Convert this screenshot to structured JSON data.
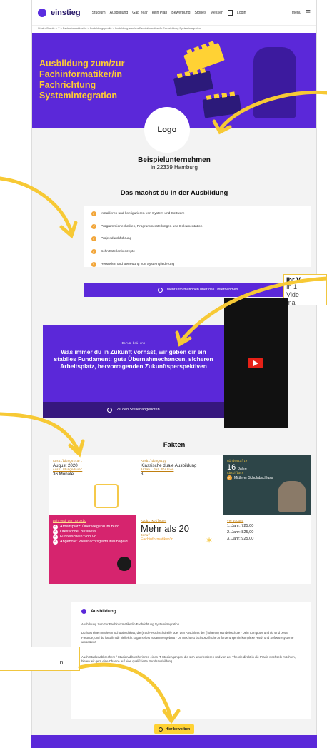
{
  "nav": {
    "brand": "einstieg",
    "links": [
      "Studium",
      "Ausbildung",
      "Gap Year",
      "kein Plan",
      "Bewerbung",
      "Stories",
      "Messen"
    ],
    "login": "Login",
    "menu": "menü"
  },
  "breadcrumb": "Start > Berufe A-Z > Fachinformatiker/-in > Ausbildungsprofile > Ausbildung zum/zur Fachinformatiker/in Fachrichtung Systemintegration",
  "hero": {
    "title": "Ausbildung zum/zur Fachinformatiker/in Fachrichtung Systemintegration",
    "logo": "Logo"
  },
  "company": {
    "name": "Beispielunternehmen",
    "city": "in 22339 Hamburg"
  },
  "training": {
    "heading": "Das machst du in der Ausbildung",
    "items": [
      "Installieren und konfigurieren von System und Software",
      "Programmiertechniken, Programmerstellungen und Dokumentation",
      "Projektdurchführung",
      "Schnittstellenkonzepte",
      "Herstellen und Betreuung von Systemgliederung"
    ],
    "more": "Mehr Informationen über das Unternehmen"
  },
  "banner": {
    "tag": "Darum bei uns",
    "text": "Was immer du in Zukunft vorhast, wir geben dir ein stabiles Fundament: gute Übernahmechancen, sicheren Arbeitsplatz, hervorragenden Zukunftsperspektiven",
    "cta": "Zu den Stellenangeboten"
  },
  "side_note": {
    "title": "Ihr V",
    "lines": [
      "In 1",
      "Vide",
      "mal"
    ]
  },
  "side_note2": "n.",
  "facts": {
    "heading": "Fakten",
    "start_label": "Ausbildungsstart",
    "start_value": "August 2020",
    "duration_label": "Ausbildungsdauer",
    "duration_value": "36 Monate",
    "type_label": "Ausbildungstyp",
    "type_value": "Klassische duale Ausbildung",
    "positions_label": "Anzahl der Stellen",
    "positions_value": "3",
    "age_label": "Mindestalter",
    "age_value": "16",
    "age_unit": "Jahre",
    "grad_label": "Abschluss",
    "grad_value": "Mittlerer Schulabschluss",
    "work_label": "Während der Arbeit",
    "work_items": [
      "Arbeitsplatz: Überwiegend im Büro",
      "Dresscode: Business",
      "Führerschein: von Vo",
      "Angebote: Weihnachtsgeld/Urlaubsgeld"
    ],
    "coll_label": "Azubi Kollegen",
    "coll_value": "Mehr als 20",
    "job_label": "Beruf",
    "job_value": "Fachinformatiker/in",
    "pay_label": "Vergütung",
    "pay_items": [
      "1. Jahr: 725,00",
      "2. Jahr: 825,00",
      "3. Jahr: 925,00"
    ]
  },
  "desc": {
    "title": "Ausbildung",
    "subtitle": "Ausbildung zum/zur Fachinformatiker/in Fachrichtung Systemintegration",
    "p1": "Du hast einen mittleren Schulabschluss, die (Fach-)Hochschulreife oder den Abschluss der (höheren) Handelsschule? Dein Computer und du sind beste Freunde, und du hast ihn dir vielleicht sogar selbst zusammengebaut? Du möchtest fachspezifische Anforderungen in komplexe Hard- und Softwaresysteme umsetzen?",
    "p2": "Auch Studienabbrechern / Studienabbrecherinnen eines IT-Studienganges, die sich umorientieren und von der Theorie direkt in die Praxis wechseln möchten, bieten wir gern eine Chance auf eine qualifizierte Berufsausbildung."
  },
  "apply": "Hier bewerben",
  "colors": {
    "purple": "#5b28d9",
    "yellow": "#ffd234",
    "orange": "#f2a63a",
    "pink": "#d6246e",
    "dark": "#2d4548"
  }
}
